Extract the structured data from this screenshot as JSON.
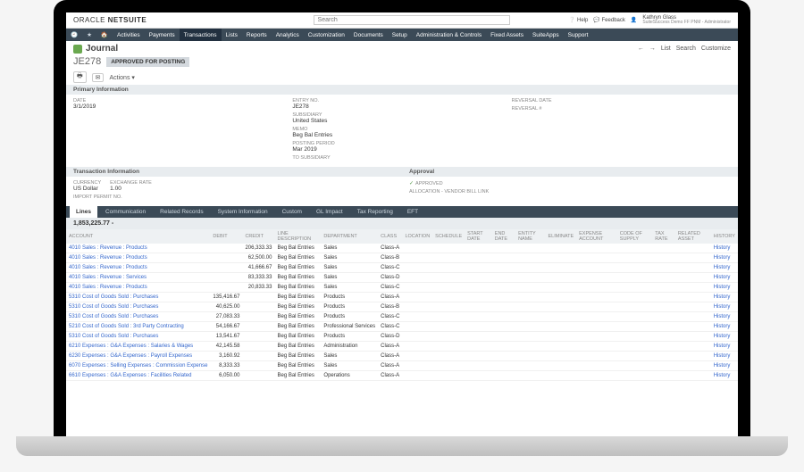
{
  "brand": {
    "oracle": "ORACLE",
    "product": "NETSUITE"
  },
  "search": {
    "placeholder": "Search"
  },
  "topright": {
    "help": "Help",
    "feedback": "Feedback",
    "user_name": "Kathryn Glass",
    "user_role": "SuiteSuccess Demo FF PNM - Administrator"
  },
  "nav": {
    "items": [
      "Activities",
      "Payments",
      "Transactions",
      "Lists",
      "Reports",
      "Analytics",
      "Customization",
      "Documents",
      "Setup",
      "Administration & Controls",
      "Fixed Assets",
      "SuiteApps",
      "Support"
    ],
    "active_index": 2
  },
  "page": {
    "title": "Journal",
    "id": "JE278",
    "status": "APPROVED FOR POSTING",
    "actions_label": "Actions",
    "right_links": {
      "back": "←",
      "fwd": "→",
      "list": "List",
      "search": "Search",
      "customize": "Customize"
    }
  },
  "primary": {
    "title": "Primary Information",
    "date_lbl": "DATE",
    "date": "3/1/2019",
    "entry_lbl": "ENTRY NO.",
    "entry": "JE278",
    "subsidiary_lbl": "SUBSIDIARY",
    "subsidiary": "United States",
    "memo_lbl": "MEMO",
    "memo": "Beg Bal Entries",
    "period_lbl": "POSTING PERIOD",
    "period": "Mar 2019",
    "tosub_lbl": "TO SUBSIDIARY",
    "revdate_lbl": "REVERSAL DATE",
    "revnum_lbl": "REVERSAL #"
  },
  "txn": {
    "title": "Transaction Information",
    "currency_lbl": "CURRENCY",
    "currency": "US Dollar",
    "rate_lbl": "EXCHANGE RATE",
    "rate": "1.00",
    "permit_lbl": "IMPORT PERMIT NO."
  },
  "approval": {
    "title": "Approval",
    "approved_lbl": "APPROVED",
    "alloc_lbl": "ALLOCATION - VENDOR BILL LINK"
  },
  "tabs": {
    "items": [
      "Lines",
      "Communication",
      "Related Records",
      "System Information",
      "Custom",
      "GL Impact",
      "Tax Reporting",
      "EFT"
    ],
    "active_index": 0
  },
  "sum": "1,853,225.77",
  "columns": [
    "ACCOUNT",
    "DEBIT",
    "CREDIT",
    "LINE DESCRIPTION",
    "DEPARTMENT",
    "CLASS",
    "LOCATION",
    "SCHEDULE",
    "START DATE",
    "END DATE",
    "ENTITY NAME",
    "ELIMINATE",
    "EXPENSE ACCOUNT",
    "CODE OF SUPPLY",
    "TAX RATE",
    "RELATED ASSET",
    "HISTORY"
  ],
  "rows": [
    {
      "acct": "4010 Sales : Revenue : Products",
      "debit": "",
      "credit": "206,333.33",
      "desc": "Beg Bal Entries",
      "dept": "Sales",
      "class": "Class-A"
    },
    {
      "acct": "4010 Sales : Revenue : Products",
      "debit": "",
      "credit": "62,500.00",
      "desc": "Beg Bal Entries",
      "dept": "Sales",
      "class": "Class-B"
    },
    {
      "acct": "4010 Sales : Revenue : Products",
      "debit": "",
      "credit": "41,666.67",
      "desc": "Beg Bal Entries",
      "dept": "Sales",
      "class": "Class-C"
    },
    {
      "acct": "4010 Sales : Revenue : Services",
      "debit": "",
      "credit": "83,333.33",
      "desc": "Beg Bal Entries",
      "dept": "Sales",
      "class": "Class-D"
    },
    {
      "acct": "4010 Sales : Revenue : Products",
      "debit": "",
      "credit": "20,833.33",
      "desc": "Beg Bal Entries",
      "dept": "Sales",
      "class": "Class-C"
    },
    {
      "acct": "5310 Cost of Goods Sold : Purchases",
      "debit": "135,416.67",
      "credit": "",
      "desc": "Beg Bal Entries",
      "dept": "Products",
      "class": "Class-A"
    },
    {
      "acct": "5310 Cost of Goods Sold : Purchases",
      "debit": "40,625.00",
      "credit": "",
      "desc": "Beg Bal Entries",
      "dept": "Products",
      "class": "Class-B"
    },
    {
      "acct": "5310 Cost of Goods Sold : Purchases",
      "debit": "27,083.33",
      "credit": "",
      "desc": "Beg Bal Entries",
      "dept": "Products",
      "class": "Class-C"
    },
    {
      "acct": "5210 Cost of Goods Sold : 3rd Party Contracting",
      "debit": "54,166.67",
      "credit": "",
      "desc": "Beg Bal Entries",
      "dept": "Professional Services",
      "class": "Class-C"
    },
    {
      "acct": "5310 Cost of Goods Sold : Purchases",
      "debit": "13,541.67",
      "credit": "",
      "desc": "Beg Bal Entries",
      "dept": "Products",
      "class": "Class-D"
    },
    {
      "acct": "6210 Expenses : G&A Expenses : Salaries & Wages",
      "debit": "42,145.58",
      "credit": "",
      "desc": "Beg Bal Entries",
      "dept": "Administration",
      "class": "Class-A"
    },
    {
      "acct": "6230 Expenses : G&A Expenses : Payroll Expenses",
      "debit": "3,160.92",
      "credit": "",
      "desc": "Beg Bal Entries",
      "dept": "Sales",
      "class": "Class-A"
    },
    {
      "acct": "6070 Expenses : Selling Expenses : Commission Expense",
      "debit": "8,333.33",
      "credit": "",
      "desc": "Beg Bal Entries",
      "dept": "Sales",
      "class": "Class-A"
    },
    {
      "acct": "6610 Expenses : G&A Expenses : Facilities Related",
      "debit": "6,050.00",
      "credit": "",
      "desc": "Beg Bal Entries",
      "dept": "Operations",
      "class": "Class-A"
    }
  ],
  "history_label": "History"
}
